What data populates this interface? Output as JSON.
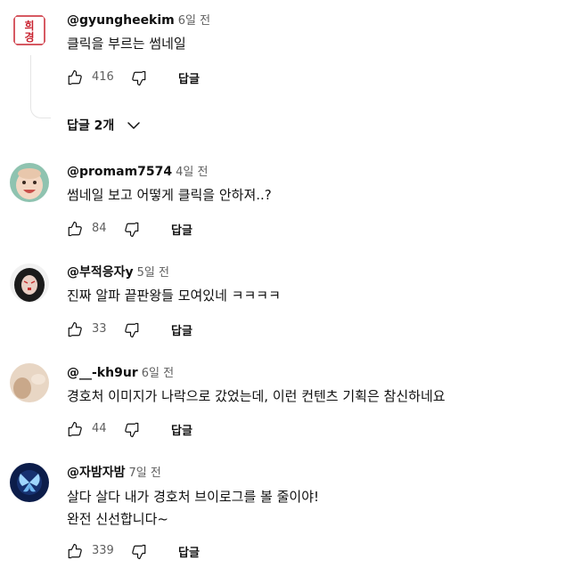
{
  "comments": [
    {
      "author": "@gyungheekim",
      "time": "6일 전",
      "text": "클릭을 부르는 썸네일",
      "likes": "416",
      "reply_label": "답글",
      "avatar": "red-seal-logo-avatar",
      "avatar_text": "희경"
    },
    {
      "author": "@promam7574",
      "time": "4일 전",
      "text": "썸네일 보고 어떻게 클릭을 안하져..?",
      "likes": "84",
      "reply_label": "답글",
      "avatar": "baby-photo-avatar"
    },
    {
      "author": "@부적응자y",
      "time": "5일 전",
      "text": "진짜 알파 끝판왕들 모여있네 ㅋㅋㅋㅋ",
      "likes": "33",
      "reply_label": "답글",
      "avatar": "dark-face-avatar"
    },
    {
      "author": "@__-kh9ur",
      "time": "6일 전",
      "text": "경호처 이미지가 나락으로 갔었는데, 이런 컨텐츠 기획은 참신하네요",
      "likes": "44",
      "reply_label": "답글",
      "avatar": "beige-hand-avatar"
    },
    {
      "author": "@자밤자밤",
      "time": "7일 전",
      "text_lines": [
        "살다 살다 내가 경호처 브이로그를 볼 줄이야!",
        "완전 신선합니다~"
      ],
      "likes": "339",
      "reply_label": "답글",
      "avatar": "blue-butterfly-avatar"
    }
  ],
  "replies_toggle": {
    "label": "답글 2개",
    "icon": "chevron-down-icon"
  },
  "colors": {
    "text_primary": "#0f0f0f",
    "text_secondary": "#606060",
    "divider": "#e5e5e5"
  }
}
